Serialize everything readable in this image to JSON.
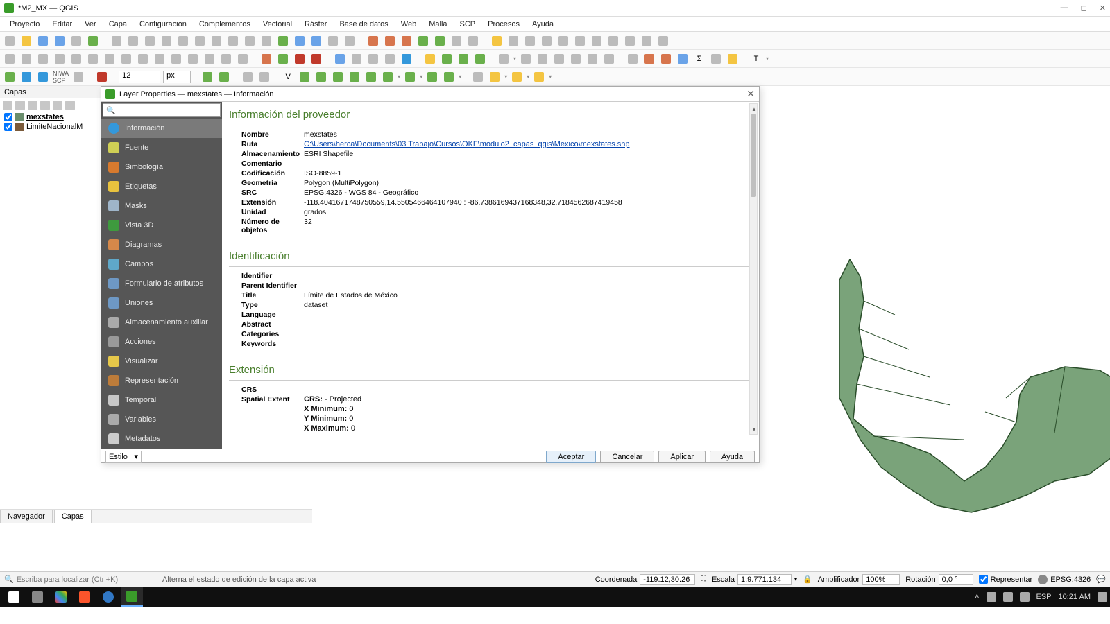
{
  "window": {
    "title": "*M2_MX — QGIS"
  },
  "menubar": [
    "Proyecto",
    "Editar",
    "Ver",
    "Capa",
    "Configuración",
    "Complementos",
    "Vectorial",
    "Ráster",
    "Base de datos",
    "Web",
    "Malla",
    "SCP",
    "Procesos",
    "Ayuda"
  ],
  "toolbar3": {
    "num": "12",
    "unit": "px"
  },
  "layers_panel": {
    "title": "Capas",
    "items": [
      {
        "name": "mexstates",
        "checked": true,
        "color": "#6a8e6d",
        "selected": true
      },
      {
        "name": "LimiteNacionalM",
        "checked": true,
        "color": "#7a5a3a",
        "selected": false
      }
    ],
    "tabs": [
      "Navegador",
      "Capas"
    ]
  },
  "dialog": {
    "title": "Layer Properties — mexstates — Información",
    "search_placeholder": "",
    "nav": [
      "Información",
      "Fuente",
      "Simbología",
      "Etiquetas",
      "Masks",
      "Vista 3D",
      "Diagramas",
      "Campos",
      "Formulario de atributos",
      "Uniones",
      "Almacenamiento auxiliar",
      "Acciones",
      "Visualizar",
      "Representación",
      "Temporal",
      "Variables",
      "Metadatos"
    ],
    "provider": {
      "heading": "Información del proveedor",
      "rows": {
        "nombre_l": "Nombre",
        "nombre_v": "mexstates",
        "ruta_l": "Ruta",
        "ruta_v": "C:\\Users\\herca\\Documents\\03 Trabajo\\Cursos\\OKF\\modulo2_capas_qgis\\Mexico\\mexstates.shp",
        "alm_l": "Almacenamiento",
        "alm_v": "ESRI Shapefile",
        "com_l": "Comentario",
        "com_v": "",
        "cod_l": "Codificación",
        "cod_v": "ISO-8859-1",
        "geo_l": "Geometría",
        "geo_v": "Polygon (MultiPolygon)",
        "src_l": "SRC",
        "src_v": "EPSG:4326 - WGS 84 - Geográfico",
        "ext_l": "Extensión",
        "ext_v": "-118.4041671748750559,14.5505466464107940 : -86.7386169437168348,32.7184562687419458",
        "uni_l": "Unidad",
        "uni_v": "grados",
        "nob_l": "Número de objetos",
        "nob_v": "32"
      }
    },
    "ident": {
      "heading": "Identificación",
      "rows": {
        "id_l": "Identifier",
        "id_v": "",
        "pid_l": "Parent Identifier",
        "pid_v": "",
        "title_l": "Title",
        "title_v": "Límite de Estados de México",
        "type_l": "Type",
        "type_v": "dataset",
        "lang_l": "Language",
        "lang_v": "",
        "abs_l": "Abstract",
        "abs_v": "",
        "cat_l": "Categories",
        "cat_v": "",
        "key_l": "Keywords",
        "key_v": ""
      }
    },
    "extent": {
      "heading": "Extensión",
      "crs_l": "CRS",
      "sp_l": "Spatial Extent",
      "crs_label": "CRS:",
      "crs_v": " - Projected",
      "xmin_l": "X Minimum:",
      "xmin_v": " 0",
      "ymin_l": "Y Minimum:",
      "ymin_v": " 0",
      "xmax_l": "X Maximum:",
      "xmax_v": " 0"
    },
    "footer": {
      "style": "Estilo",
      "ok": "Aceptar",
      "cancel": "Cancelar",
      "apply": "Aplicar",
      "help": "Ayuda"
    }
  },
  "statusbar": {
    "locator_placeholder": "Escriba para localizar (Ctrl+K)",
    "hint": "Alterna el estado de edición de la capa activa",
    "coord_l": "Coordenada",
    "coord_v": "-119.12,30.26",
    "scale_l": "Escala",
    "scale_v": "1:9.771.134",
    "mag_l": "Amplificador",
    "mag_v": "100%",
    "rot_l": "Rotación",
    "rot_v": "0,0 °",
    "render_l": "Representar",
    "crs": "EPSG:4326"
  },
  "taskbar": {
    "lang": "ESP",
    "time": "10:21 AM"
  }
}
